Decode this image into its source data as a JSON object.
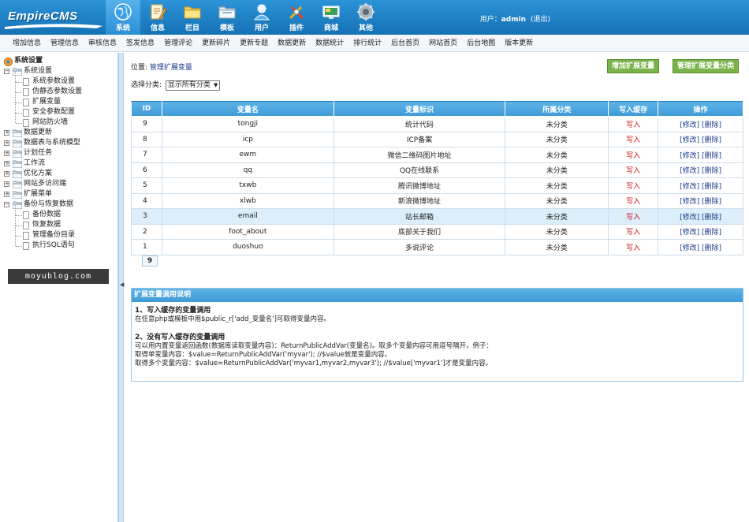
{
  "header": {
    "logo_text": "EmpireCMS",
    "nav": [
      {
        "label": "系统",
        "icon": "globe-icon",
        "active": true
      },
      {
        "label": "信息",
        "icon": "pencil-note-icon",
        "active": false
      },
      {
        "label": "栏目",
        "icon": "folder-icon",
        "active": false
      },
      {
        "label": "模板",
        "icon": "template-folder-icon",
        "active": false
      },
      {
        "label": "用户",
        "icon": "user-icon",
        "active": false
      },
      {
        "label": "插件",
        "icon": "plugin-tools-icon",
        "active": false
      },
      {
        "label": "商城",
        "icon": "shop-screen-icon",
        "active": false
      },
      {
        "label": "其他",
        "icon": "gear-icon",
        "active": false
      }
    ],
    "user_label": "用户：",
    "user_name": "admin",
    "logout": "(退出)"
  },
  "subnav": [
    "增加信息",
    "管理信息",
    "审核信息",
    "签发信息",
    "管理评论",
    "更新碎片",
    "更新专题",
    "数据更新",
    "数据统计",
    "排行统计",
    "后台首页",
    "网站首页",
    "后台地图",
    "版本更新"
  ],
  "sidebar": {
    "items": [
      {
        "label": "系统设置",
        "level": 0,
        "type": "root"
      },
      {
        "label": "系统设置",
        "level": 1,
        "type": "folder-open"
      },
      {
        "label": "系统参数设置",
        "level": 2,
        "type": "page"
      },
      {
        "label": "伪静态参数设置",
        "level": 2,
        "type": "page"
      },
      {
        "label": "扩展变量",
        "level": 2,
        "type": "page"
      },
      {
        "label": "安全参数配置",
        "level": 2,
        "type": "page"
      },
      {
        "label": "网站防火墙",
        "level": 2,
        "type": "page"
      },
      {
        "label": "数据更新",
        "level": 1,
        "type": "folder"
      },
      {
        "label": "数据表与系统模型",
        "level": 1,
        "type": "folder"
      },
      {
        "label": "计划任务",
        "level": 1,
        "type": "folder"
      },
      {
        "label": "工作流",
        "level": 1,
        "type": "folder"
      },
      {
        "label": "优化方案",
        "level": 1,
        "type": "folder"
      },
      {
        "label": "网站多访问端",
        "level": 1,
        "type": "folder"
      },
      {
        "label": "扩展菜单",
        "level": 1,
        "type": "folder"
      },
      {
        "label": "备份与恢复数据",
        "level": 1,
        "type": "folder-open"
      },
      {
        "label": "备份数据",
        "level": 2,
        "type": "page"
      },
      {
        "label": "恢复数据",
        "level": 2,
        "type": "page"
      },
      {
        "label": "管理备份目录",
        "level": 2,
        "type": "page"
      },
      {
        "label": "执行SQL语句",
        "level": 2,
        "type": "page"
      }
    ],
    "watermark": "moyublog.com"
  },
  "main": {
    "breadcrumb_prefix": "位置:",
    "breadcrumb_link": "管理扩展变量",
    "btn_add": "增加扩展变量",
    "btn_manage_class": "管理扩展变量分类",
    "select_label": "选择分类:",
    "select_value": "显示所有分类",
    "table": {
      "headers": [
        "ID",
        "变量名",
        "变量标识",
        "所属分类",
        "写入缓存",
        "操作"
      ],
      "rows": [
        {
          "id": "9",
          "name": "tongji",
          "label": "统计代码",
          "class": "未分类",
          "cache": "写入",
          "ops": "[修改] [删除]",
          "highlight": false
        },
        {
          "id": "8",
          "name": "icp",
          "label": "ICP备案",
          "class": "未分类",
          "cache": "写入",
          "ops": "[修改] [删除]",
          "highlight": false
        },
        {
          "id": "7",
          "name": "ewm",
          "label": "微信二维码图片地址",
          "class": "未分类",
          "cache": "写入",
          "ops": "[修改] [删除]",
          "highlight": false
        },
        {
          "id": "6",
          "name": "qq",
          "label": "QQ在线联系",
          "class": "未分类",
          "cache": "写入",
          "ops": "[修改] [删除]",
          "highlight": false
        },
        {
          "id": "5",
          "name": "txwb",
          "label": "腾讯微博地址",
          "class": "未分类",
          "cache": "写入",
          "ops": "[修改] [删除]",
          "highlight": false
        },
        {
          "id": "4",
          "name": "xlwb",
          "label": "新浪微博地址",
          "class": "未分类",
          "cache": "写入",
          "ops": "[修改] [删除]",
          "highlight": false
        },
        {
          "id": "3",
          "name": "email",
          "label": "站长邮箱",
          "class": "未分类",
          "cache": "写入",
          "ops": "[修改] [删除]",
          "highlight": true
        },
        {
          "id": "2",
          "name": "foot_about",
          "label": "底部关于我们",
          "class": "未分类",
          "cache": "写入",
          "ops": "[修改] [删除]",
          "highlight": false
        },
        {
          "id": "1",
          "name": "duoshuo",
          "label": "多说评论",
          "class": "未分类",
          "cache": "写入",
          "ops": "[修改] [删除]",
          "highlight": false
        }
      ],
      "page": "9"
    },
    "info": {
      "title": "扩展变量调用说明",
      "h1": "1、写入缓存的变量调用",
      "p1": "在任意php或模板中用$public_r['add_变量名']可取得变量内容。",
      "h2": "2、没有写入缓存的变量调用",
      "p2": "可以用内置变量返回函数(数据库读取变量内容)：ReturnPublicAddVar(变量名)。取多个变量内容可用逗号隔开，例子：",
      "p3": "取得单变量内容：$value=ReturnPublicAddVar('myvar'); //$value就是变量内容。",
      "p4": "取得多个变量内容：$value=ReturnPublicAddVar('myvar1,myvar2,myvar3'); //$value['myvar1']才是变量内容。"
    }
  },
  "colors": {
    "header_blue": "#1f80c6",
    "table_header": "#4aa6de",
    "button_green": "#7ab34a",
    "cache_red": "#d01010",
    "link_blue": "#1a3a8c"
  }
}
